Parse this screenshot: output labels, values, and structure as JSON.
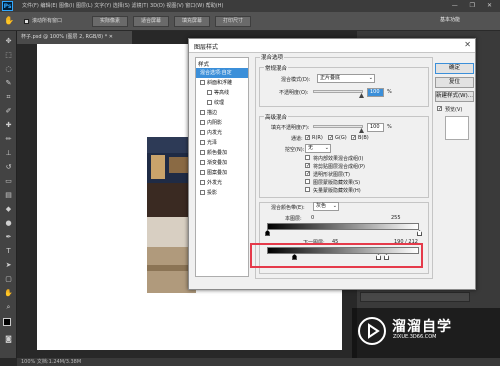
{
  "menubar": {
    "app_logo": "Ps",
    "menus": "文件(F)  编辑(E)  图像(I)  图层(L)  文字(Y)  选择(S)  滤镜(T)  3D(D)  视图(V)  窗口(W)  帮助(H)",
    "window_controls": "— ❐ ✕"
  },
  "options_bar": {
    "btn_all_windows_label": "滚动所有窗口",
    "btn_actual_pixels": "实际像素",
    "btn_fit_screen": "适合屏幕",
    "btn_fill_screen": "填充屏幕",
    "btn_print_size": "打印尺寸",
    "workspace_label": "基本功能"
  },
  "document": {
    "tab_title": "杯子.psd @ 100% (图层 2, RGB/8) * ✕",
    "status": "100%   文档:1.24M/3.38M"
  },
  "dialog": {
    "title": "图层样式",
    "close": "✕",
    "styles_header": "样式",
    "styles": [
      {
        "label": "混合选项:自定",
        "active": true,
        "checkbox": false,
        "sub": false
      },
      {
        "label": "斜面和浮雕",
        "active": false,
        "checkbox": true,
        "sub": false
      },
      {
        "label": "等高线",
        "active": false,
        "checkbox": true,
        "sub": true
      },
      {
        "label": "纹理",
        "active": false,
        "checkbox": true,
        "sub": true
      },
      {
        "label": "描边",
        "active": false,
        "checkbox": true,
        "sub": false
      },
      {
        "label": "内阴影",
        "active": false,
        "checkbox": true,
        "sub": false
      },
      {
        "label": "内发光",
        "active": false,
        "checkbox": true,
        "sub": false
      },
      {
        "label": "光泽",
        "active": false,
        "checkbox": true,
        "sub": false
      },
      {
        "label": "颜色叠加",
        "active": false,
        "checkbox": true,
        "sub": false
      },
      {
        "label": "渐变叠加",
        "active": false,
        "checkbox": true,
        "sub": false
      },
      {
        "label": "图案叠加",
        "active": false,
        "checkbox": true,
        "sub": false
      },
      {
        "label": "外发光",
        "active": false,
        "checkbox": true,
        "sub": false
      },
      {
        "label": "投影",
        "active": false,
        "checkbox": true,
        "sub": false
      }
    ],
    "blend_options": {
      "legend": "混合选项",
      "general_legend": "常规混合",
      "blend_mode_label": "混合模式(D):",
      "blend_mode_value": "正片叠底",
      "opacity_label": "不透明度(O):",
      "opacity_value": "100",
      "percent": "%"
    },
    "advanced": {
      "legend": "高级混合",
      "fill_opacity_label": "填充不透明度(F):",
      "fill_opacity_value": "100",
      "percent": "%",
      "channels_label": "通道:",
      "channel_r": "R(R)",
      "channel_g": "G(G)",
      "channel_b": "B(B)",
      "knockout_label": "挖空(N):",
      "knockout_value": "无",
      "options": [
        {
          "label": "将内部效果混合成组(I)",
          "checked": false
        },
        {
          "label": "将剪贴图层混合成组(P)",
          "checked": true
        },
        {
          "label": "透明形状图层(T)",
          "checked": true
        },
        {
          "label": "图层蒙版隐藏效果(S)",
          "checked": false
        },
        {
          "label": "矢量蒙版隐藏效果(H)",
          "checked": false
        }
      ]
    },
    "blend_if": {
      "label": "混合颜色带(E):",
      "value": "灰色",
      "this_layer_label": "本图层:",
      "this_layer_min": "0",
      "this_layer_max": "255",
      "underlying_label": "下一图层:",
      "underlying_min": "45",
      "underlying_max": "190 / 212"
    },
    "buttons": {
      "ok": "确定",
      "reset": "复位",
      "new_style": "新建样式(W)...",
      "preview": "预览(V)"
    }
  },
  "watermark": {
    "text": "溜溜自学",
    "url": "ZIXUE.3D66.COM"
  },
  "colors": {
    "accent": "#3b8fd9",
    "highlight": "#e53a4a",
    "ps_bg": "#282828"
  }
}
